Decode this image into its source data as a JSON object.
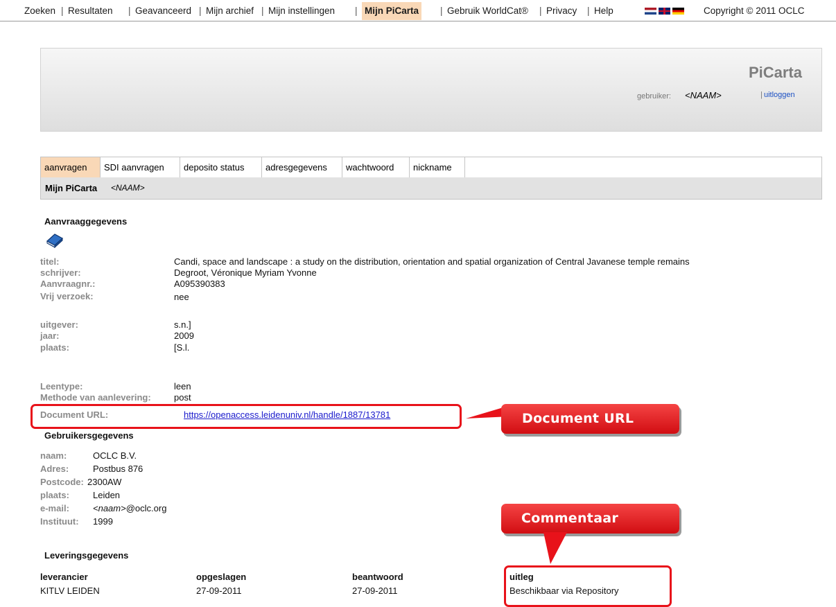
{
  "topnav": {
    "items": [
      "Zoeken",
      "Resultaten",
      "Geavanceerd",
      "Mijn archief",
      "Mijn instellingen",
      "Mijn PiCarta",
      "Gebruik WorldCat®",
      "Privacy",
      "Help"
    ],
    "separator": "|",
    "copyright": "Copyright © 2011 OCLC",
    "active_color": "#f9d8b7"
  },
  "header": {
    "brand": "PiCarta",
    "user_label": "gebruiker:",
    "user_name": "<NAAM>",
    "logout_sep": "|",
    "logout": "uitloggen"
  },
  "tabs": [
    "aanvragen",
    "SDI aanvragen",
    "deposito status",
    "adresgegevens",
    "wachtwoord",
    "nickname"
  ],
  "subbar": {
    "title": "Mijn PiCarta",
    "name": "<NAAM>"
  },
  "request": {
    "heading": "Aanvraaggegevens",
    "icon": "book-icon",
    "fields": [
      {
        "label": "titel:",
        "value": "Candi, space and landscape : a study on the distribution, orientation and spatial organization of Central Javanese temple remains"
      },
      {
        "label": "schrijver:",
        "value": "Degroot, Véronique Myriam Yvonne"
      },
      {
        "label": "Aanvraagnr.:",
        "value": "A095390383"
      },
      {
        "label": "Vrij verzoek:",
        "value": "nee"
      },
      {
        "label": "uitgever:",
        "value": "s.n.]"
      },
      {
        "label": "jaar:",
        "value": "2009"
      },
      {
        "label": "plaats:",
        "value": "[S.l."
      },
      {
        "label": "Leentype:",
        "value": "leen"
      },
      {
        "label": "Methode van aanlevering:",
        "value": "post"
      },
      {
        "label": "Document URL:",
        "value": "https://openaccess.leidenuniv.nl/handle/1887/13781"
      }
    ]
  },
  "user": {
    "heading": "Gebruikersgegevens",
    "fields": [
      {
        "label": "naam:",
        "value": "OCLC B.V."
      },
      {
        "label": "Adres:",
        "value": "Postbus 876"
      },
      {
        "label": "Postcode:",
        "value": "2300AW"
      },
      {
        "label": "plaats:",
        "value": "Leiden"
      },
      {
        "label": "e-mail:",
        "value_italic": "<naam>",
        "value": "@oclc.org"
      },
      {
        "label": "Instituut:",
        "value": "1999"
      }
    ]
  },
  "delivery": {
    "heading": "Leveringsgegevens",
    "columns": [
      {
        "header": "leverancier",
        "value": "KITLV LEIDEN"
      },
      {
        "header": "opgeslagen",
        "value": "27-09-2011"
      },
      {
        "header": "beantwoord",
        "value": "27-09-2011"
      },
      {
        "header": "uitleg",
        "value": "Beschikbaar via Repository"
      }
    ]
  },
  "annotations": {
    "url_callout": "Document URL",
    "comment_callout": "Commentaar",
    "color": "#e8121a"
  }
}
